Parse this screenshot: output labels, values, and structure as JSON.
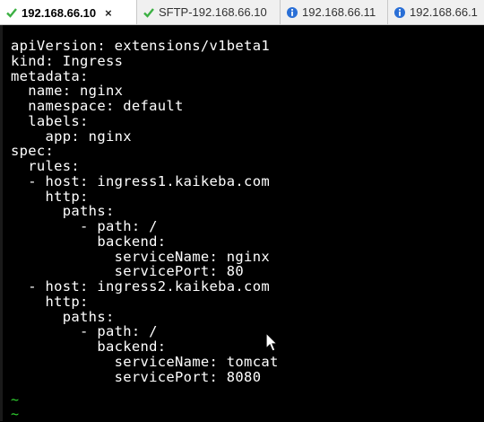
{
  "tabs": [
    {
      "label": "192.168.66.10",
      "icon": "check-icon",
      "close": "×"
    },
    {
      "label": "SFTP-192.168.66.10",
      "icon": "check-icon"
    },
    {
      "label": "192.168.66.11",
      "icon": "info-icon"
    },
    {
      "label": "192.168.66.1",
      "icon": "info-icon"
    }
  ],
  "terminal": {
    "text": "apiVersion: extensions/v1beta1\nkind: Ingress\nmetadata:\n  name: nginx\n  namespace: default\n  labels:\n    app: nginx\nspec:\n  rules:\n  - host: ingress1.kaikeba.com\n    http:\n      paths:\n        - path: /\n          backend:\n            serviceName: nginx\n            servicePort: 80\n  - host: ingress2.kaikeba.com\n    http:\n      paths:\n        - path: /\n          backend:\n            serviceName: tomcat\n            servicePort: 8080",
    "tilde_1": "~",
    "tilde_2": "~"
  },
  "colors": {
    "terminal_bg": "#000000",
    "terminal_fg": "#ffffff",
    "tilde": "#2fd12f",
    "check": "#3cb043",
    "info": "#2a6fd6"
  }
}
